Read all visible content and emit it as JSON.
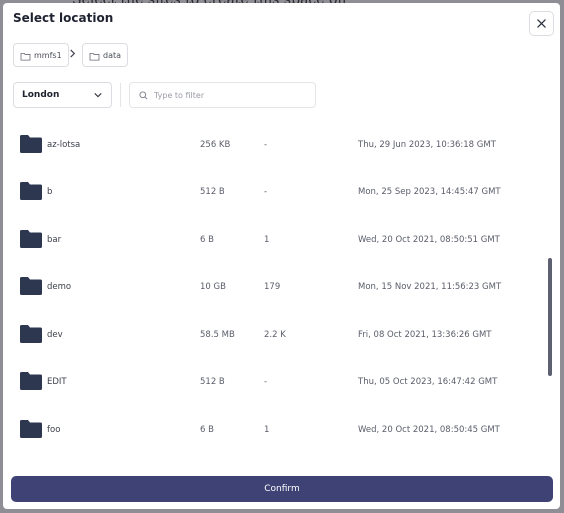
{
  "background": {
    "text": "Select the sites to create this space on"
  },
  "dialog": {
    "title": "Select location",
    "close_icon": "close-icon"
  },
  "breadcrumbs": [
    {
      "label": "mmfs1",
      "icon": "folder-icon"
    },
    {
      "label": "data",
      "icon": "folder-icon"
    }
  ],
  "location_select": {
    "value": "London",
    "icon": "chevron-down-icon"
  },
  "filter": {
    "placeholder": "Type to filter",
    "value": "",
    "icon": "search-icon"
  },
  "rows": [
    {
      "name": "az-lotsa",
      "size": "256 KB",
      "count": "-",
      "modified": "Thu, 29 Jun 2023, 10:36:18 GMT"
    },
    {
      "name": "b",
      "size": "512 B",
      "count": "-",
      "modified": "Mon, 25 Sep 2023, 14:45:47 GMT"
    },
    {
      "name": "bar",
      "size": "6 B",
      "count": "1",
      "modified": "Wed, 20 Oct 2021, 08:50:51 GMT"
    },
    {
      "name": "demo",
      "size": "10 GB",
      "count": "179",
      "modified": "Mon, 15 Nov 2021, 11:56:23 GMT"
    },
    {
      "name": "dev",
      "size": "58.5 MB",
      "count": "2.2 K",
      "modified": "Fri, 08 Oct 2021, 13:36:26 GMT"
    },
    {
      "name": "EDIT",
      "size": "512 B",
      "count": "-",
      "modified": "Thu, 05 Oct 2023, 16:47:42 GMT"
    },
    {
      "name": "foo",
      "size": "6 B",
      "count": "1",
      "modified": "Wed, 20 Oct 2021, 08:50:45 GMT"
    }
  ],
  "scrollbar": {
    "position_fraction": 0.4
  },
  "confirm_label": "Confirm",
  "colors": {
    "folder": "#2e3750",
    "primary_button": "#3f4275",
    "backdrop": "#8e8e94"
  }
}
